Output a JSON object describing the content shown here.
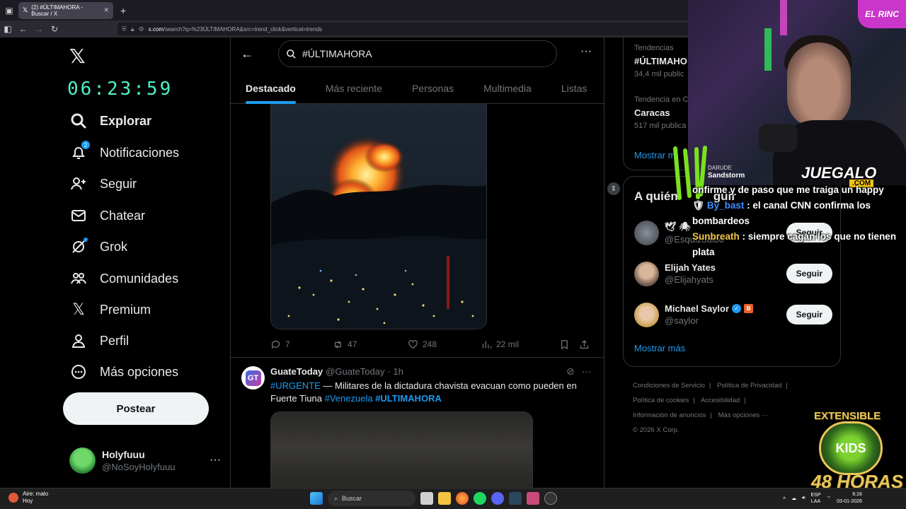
{
  "browser": {
    "tab_title": "(2) #ÚLTIMAHORA - Buscar / X",
    "url_host": "x.com",
    "url_path": "/search?q=%23ÚLTIMAHORA&src=trend_click&vertical=trends"
  },
  "sidebar": {
    "clock": "06:23:59",
    "notif_count": "2",
    "items": [
      {
        "label": "Explorar",
        "icon": "search-icon"
      },
      {
        "label": "Notificaciones",
        "icon": "bell-icon"
      },
      {
        "label": "Seguir",
        "icon": "follow-icon"
      },
      {
        "label": "Chatear",
        "icon": "mail-icon"
      },
      {
        "label": "Grok",
        "icon": "grok-icon"
      },
      {
        "label": "Comunidades",
        "icon": "communities-icon"
      },
      {
        "label": "Premium",
        "icon": "x-icon"
      },
      {
        "label": "Perfil",
        "icon": "person-icon"
      },
      {
        "label": "Más opciones",
        "icon": "more-circle-icon"
      }
    ],
    "post_button": "Postear",
    "profile": {
      "name": "Holyfuuu",
      "handle": "@NoSoyHolyfuuu"
    }
  },
  "main": {
    "search_query": "#ÚLTIMAHORA",
    "tabs": [
      "Destacado",
      "Más reciente",
      "Personas",
      "Multimedia",
      "Listas"
    ],
    "tweet1": {
      "replies": "7",
      "reposts": "47",
      "likes": "248",
      "views": "22 mil"
    },
    "tweet2": {
      "name": "GuateToday",
      "handle": "@GuateToday",
      "time": "· 1h",
      "avatar_text": "GT",
      "tag1": "#URGENTE",
      "text1": " — Militares de la dictadura chavista evacuan como pueden en Fuerte Tiuna ",
      "tag2": "#Venezuela",
      "tag3": "#ULTIMAHORA"
    }
  },
  "right": {
    "trends": [
      {
        "context": "Tendencias",
        "name": "#ÚLTIMAHO",
        "count": "34,4 mil public"
      },
      {
        "context": "Tendencia en C",
        "name": "Caracas",
        "count": "517 mil publica"
      }
    ],
    "show_more_trends": "Mostrar m",
    "who_title": "A quién",
    "who_title_tail": "guir",
    "who": [
      {
        "name": "",
        "handle": "@Esquizoalbo",
        "follow": "Seguir"
      },
      {
        "name": "Elijah Yates",
        "handle": "@Elijahyats",
        "follow": "Seguir"
      },
      {
        "name": "Michael Saylor",
        "handle": "@saylor",
        "follow": "Seguir",
        "badge": "B"
      }
    ],
    "show_more": "Mostrar más",
    "footer": [
      "Condiciones de Servicio",
      "Política de Privacidad",
      "Política de cookies",
      "Accesibilidad",
      "Información de anuncios",
      "Más opciones ···",
      "© 2026 X Corp."
    ]
  },
  "overlay": {
    "song_artist": "DARUDE",
    "song_title": "Sandstorm",
    "brand": "JUEGALO",
    "brand_com": ".COM",
    "neon_sign": "EL RINC",
    "chat": [
      {
        "user": "",
        "text": "onfirme y de paso que me traiga un happy"
      },
      {
        "user": "By_bast",
        "text": " : el canal CNN confirma los bombardeos"
      },
      {
        "user": "Sunbreath",
        "text": " : siempre cagan los que no tienen plata"
      }
    ],
    "extensible": "EXTENSIBLE",
    "kids": "KIDS",
    "horas": "48 HORAS"
  },
  "taskbar": {
    "weather_1": "Aire: malo",
    "weather_2": "Hoy",
    "search": "Buscar",
    "lang_1": "ESP",
    "lang_2": "LAA",
    "time": "6:16",
    "date": "03-01-2026"
  },
  "colors": {
    "accent": "#1d9bf0",
    "background": "#000000",
    "clock": "#4ef2c6"
  }
}
